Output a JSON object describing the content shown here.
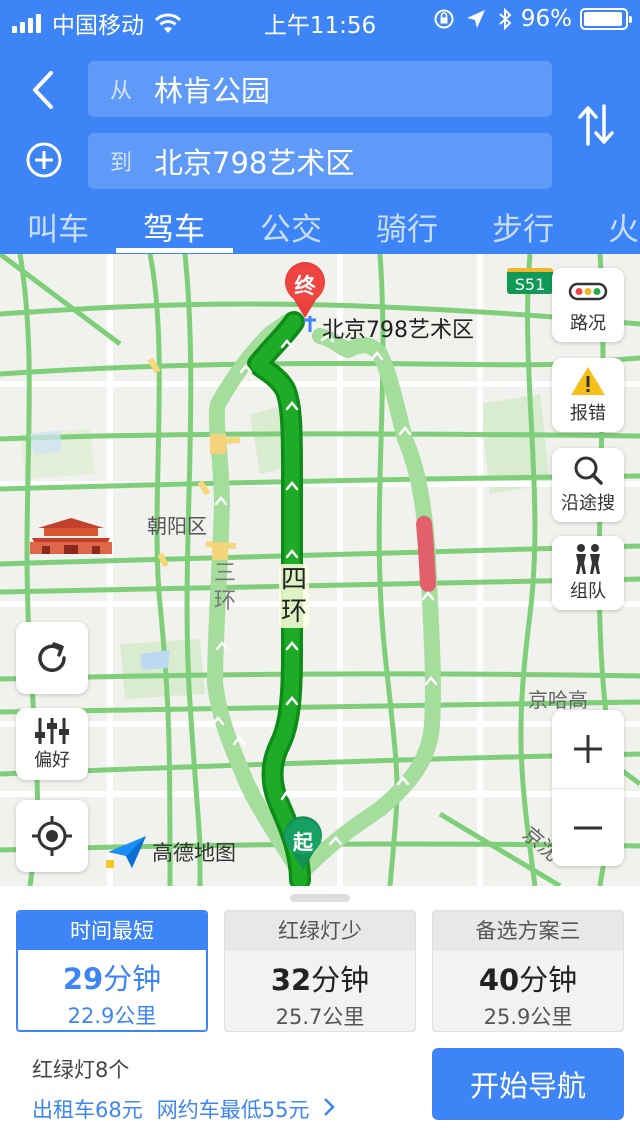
{
  "status_bar": {
    "carrier": "中国移动",
    "time": "上午11:56",
    "battery": "96%"
  },
  "search": {
    "from_prefix": "从",
    "from_value": "林肯公园",
    "to_prefix": "到",
    "to_value": "北京798艺术区"
  },
  "tabs": [
    "叫车",
    "驾车",
    "公交",
    "骑行",
    "步行",
    "火"
  ],
  "active_tab": "驾车",
  "map": {
    "destination_marker": "终",
    "destination_label": "北京798艺术区",
    "origin_marker": "起",
    "district_label": "朝阳区",
    "ring4_label": "四环",
    "ring3_label": "三环",
    "highway_badge": "S51",
    "road_label": "京哈高",
    "road_label2": "京沈",
    "logo_text": "高德地图",
    "side_buttons": [
      "路况",
      "报错",
      "沿途搜",
      "组队"
    ],
    "left_buttons": {
      "refresh": "",
      "preference": "偏好"
    }
  },
  "routes": [
    {
      "header": "时间最短",
      "minutes": "29",
      "unit": "分钟",
      "distance": "22.9公里",
      "selected": true
    },
    {
      "header": "红绿灯少",
      "minutes": "32",
      "unit": "分钟",
      "distance": "25.7公里",
      "selected": false
    },
    {
      "header": "备选方案三",
      "minutes": "40",
      "unit": "分钟",
      "distance": "25.9公里",
      "selected": false
    }
  ],
  "lights_info": "红绿灯8个",
  "taxi_fare": "出租车68元",
  "ride_hail_fare": "网约车最低55元",
  "start_nav_label": "开始导航",
  "colors": {
    "primary": "#3d84f7",
    "route_main": "#17a323",
    "route_alt": "#8fd58a",
    "congestion": "#e35f67"
  }
}
